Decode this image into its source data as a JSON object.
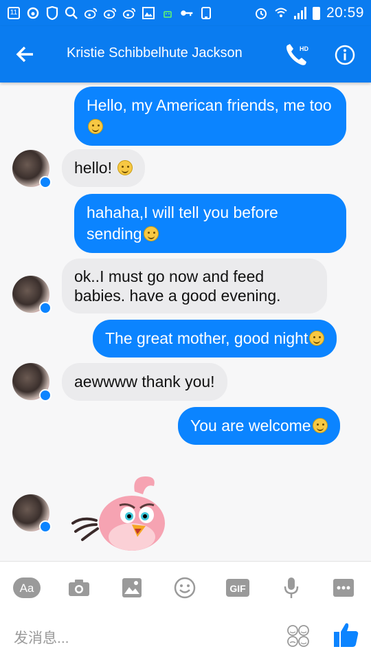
{
  "status_bar": {
    "left_icons": [
      "notification-11-icon",
      "weibo-icon",
      "shield-icon",
      "search-icon",
      "weibo-icon",
      "weibo-icon",
      "weibo-icon",
      "image-icon",
      "android-icon",
      "key-icon",
      "device-icon"
    ],
    "notification_badge": "11",
    "time": "20:59",
    "right_icons": [
      "alarm-icon",
      "wifi-icon",
      "signal-icon",
      "battery-icon"
    ]
  },
  "header": {
    "title": "Kristie Schibbelhute Jackson",
    "hd_label": "HD",
    "color": "#0a7cf0"
  },
  "messages": [
    {
      "side": "out",
      "text": "Hello, my American friends, me too",
      "emoji": "winking-face-tongue"
    },
    {
      "side": "in",
      "text": "hello! ",
      "emoji": "smiling-face"
    },
    {
      "side": "out",
      "text": "hahaha,I will tell you before sending",
      "emoji": "relieved-face"
    },
    {
      "side": "in",
      "text": "ok..I must go now and feed babies. have a good evening.",
      "emoji": ""
    },
    {
      "side": "out",
      "text": "The great mother, good night",
      "emoji": "face-with-tongue"
    },
    {
      "side": "in",
      "text": "aewwww thank you!",
      "emoji": ""
    },
    {
      "side": "out",
      "text": "You are welcome",
      "emoji": "grinning-face"
    },
    {
      "side": "in",
      "text": "",
      "sticker": "pink-bird-sticker"
    }
  ],
  "composer": {
    "aa_label": "Aa",
    "gif_label": "GIF",
    "placeholder": "发消息...",
    "tools": [
      "aa-icon",
      "camera-icon",
      "gallery-icon",
      "emoji-icon",
      "gif-icon",
      "microphone-icon",
      "more-icon"
    ]
  },
  "colors": {
    "outgoing_bubble": "#0b84ff",
    "incoming_bubble": "#ebebed",
    "accent": "#0a7cf0"
  }
}
